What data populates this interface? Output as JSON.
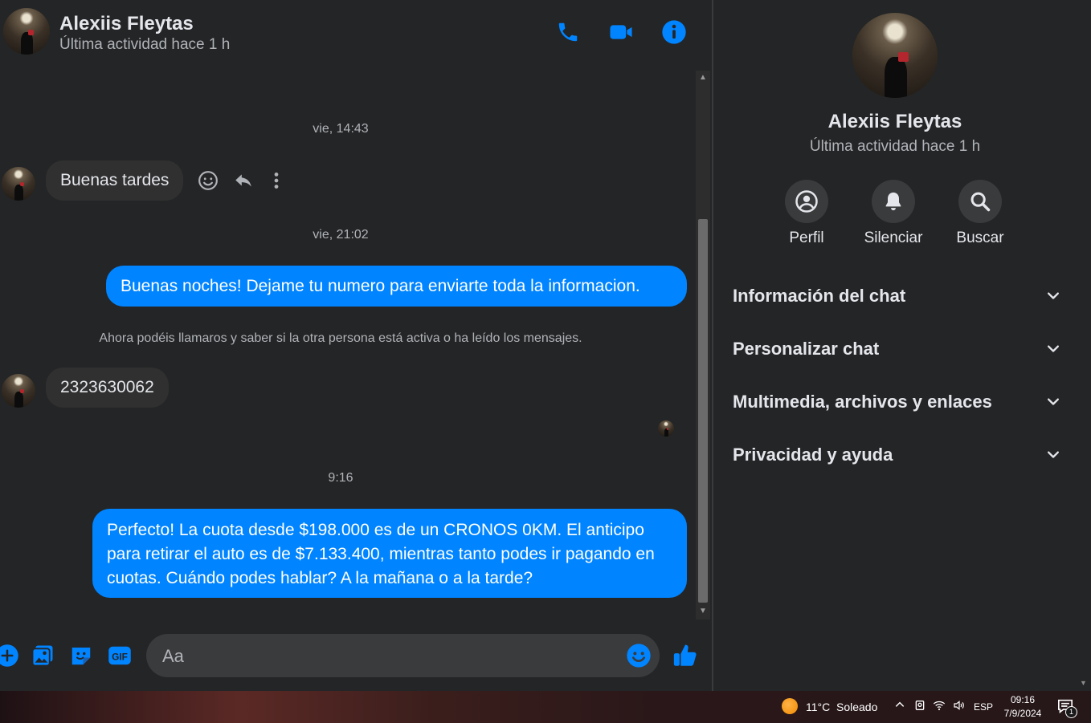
{
  "chat": {
    "contact_name": "Alexiis Fleytas",
    "contact_status": "Última actividad hace 1 h",
    "messages": {
      "sep1": "vie, 14:43",
      "msg1": "Buenas tardes",
      "sep2": "vie, 21:02",
      "msg2": "Buenas noches! Dejame tu numero para enviarte toda la informacion.",
      "notice": "Ahora podéis llamaros y saber si la otra persona está activa o ha leído los mensajes.",
      "msg3": "2323630062",
      "sep3": "9:16",
      "msg4": "Perfecto! La cuota desde $198.000 es de un CRONOS 0KM. El anticipo para retirar el auto es de $7.133.400, mientras tanto podes ir pagando en cuotas. Cuándo podes hablar? A la mañana o a la tarde?"
    },
    "composer": {
      "placeholder": "Aa",
      "value": ""
    },
    "accent": "#0084ff"
  },
  "panel": {
    "name": "Alexiis Fleytas",
    "status": "Última actividad hace 1 h",
    "actions": {
      "profile": "Perfil",
      "mute": "Silenciar",
      "search": "Buscar"
    },
    "sections": {
      "s1": "Información del chat",
      "s2": "Personalizar chat",
      "s3": "Multimedia, archivos y enlaces",
      "s4": "Privacidad y ayuda"
    }
  },
  "taskbar": {
    "temperature": "11°C",
    "weather": "Soleado",
    "language": "ESP",
    "time": "09:16",
    "date": "7/9/2024",
    "notification_count": "1"
  }
}
